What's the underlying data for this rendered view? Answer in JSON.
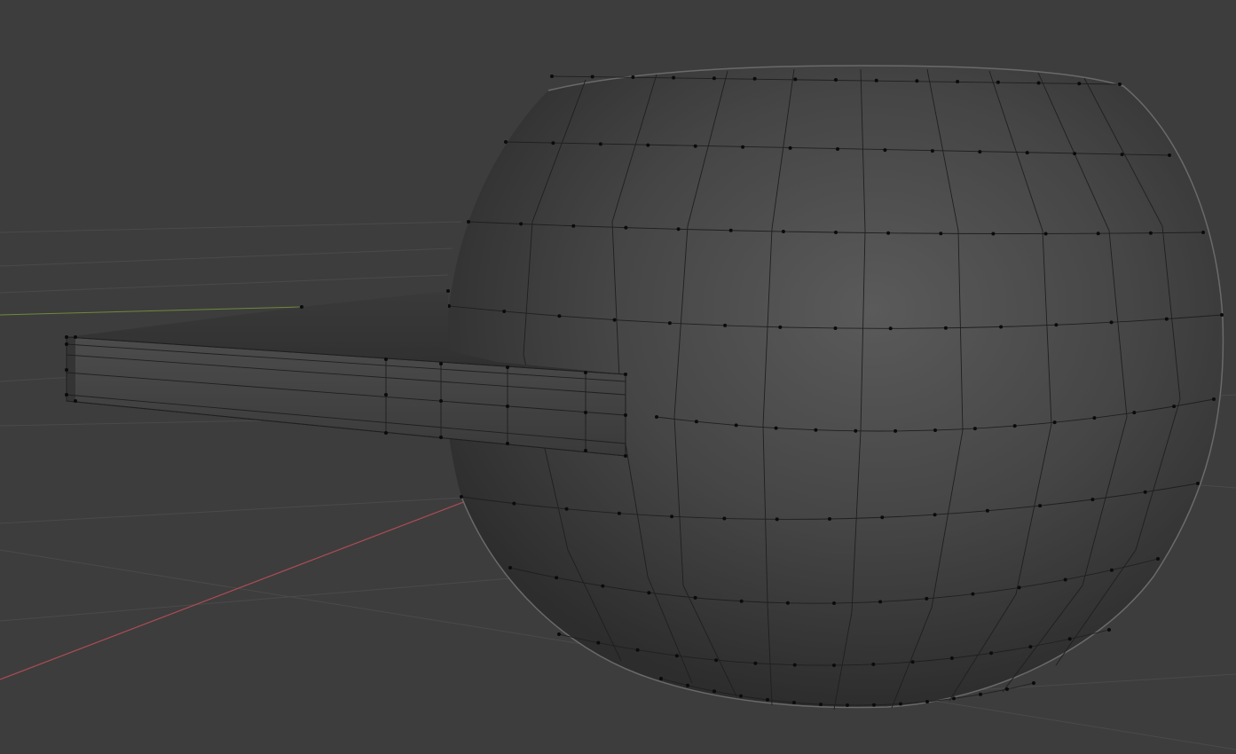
{
  "viewport": {
    "background": "#3d3d3d",
    "grid_color": "#4a4a4a",
    "x_axis_color": "#b04c55",
    "y_axis_color": "#6e8a3c",
    "wire_color": "#1f1f1f",
    "vertex_color": "#0b0b0b",
    "body_highlight": "#5b5b5b",
    "body_shadow": "#2d2d2d"
  },
  "mesh": {
    "objects": [
      {
        "name": "sphere-mesh",
        "type": "uv-sphere",
        "edit_mode": true
      },
      {
        "name": "spout-mesh",
        "type": "extruded-box",
        "edit_mode": true
      }
    ]
  }
}
